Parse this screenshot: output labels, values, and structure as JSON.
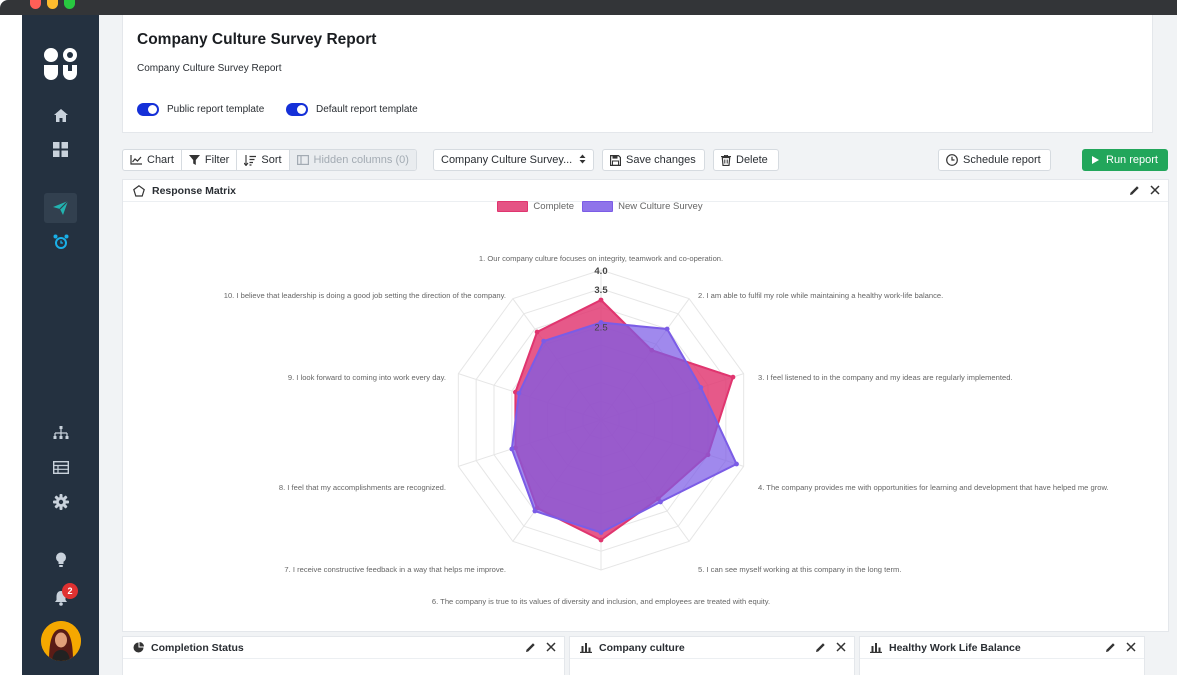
{
  "report": {
    "title": "Company Culture Survey Report",
    "subtitle": "Company Culture Survey Report",
    "toggles": [
      "Public report template",
      "Default report template"
    ]
  },
  "toolbar": {
    "chart": "Chart",
    "filter": "Filter",
    "sort": "Sort",
    "hidden_columns": "Hidden columns (0)",
    "survey_select": "Company Culture Survey...",
    "save": "Save changes",
    "delete": "Delete",
    "schedule": "Schedule report",
    "run": "Run report"
  },
  "sidebar": {
    "notification_count": "2",
    "accent": "#1ab0e8"
  },
  "panels": {
    "matrix_title": "Response Matrix",
    "bottom": [
      "Completion Status",
      "Company culture",
      "Healthy Work Life Balance"
    ]
  },
  "chart_data": {
    "type": "radar",
    "labels": [
      "1. Our company culture focuses on integrity, teamwork and co-operation.",
      "2. I am able to fulfil my role while maintaining a healthy work-life balance.",
      "3. I feel listened to in the company and my ideas are regularly implemented.",
      "4. The company provides me with opportunities for learning and development that have helped me grow.",
      "5. I can see myself working at this company in the long term.",
      "6. The company is true to its values of diversity and inclusion, and employees are treated with equity.",
      "7. I receive constructive feedback in a way that helps me improve.",
      "8. I feel that my accomplishments are recognized.",
      "9. I look forward to coming into work every day.",
      "10. I believe that leadership is doing a good job setting the direction of the company."
    ],
    "tick_labels": [
      "4.0",
      "3.5",
      "2.5"
    ],
    "r_max": 4.0,
    "series": [
      {
        "name": "Complete",
        "color": "#e0356f",
        "values": [
          3.2,
          2.3,
          3.7,
          3.0,
          2.6,
          3.2,
          2.9,
          2.4,
          2.4,
          2.9
        ]
      },
      {
        "name": "New Culture Survey",
        "color": "#7b5ce6",
        "values": [
          2.6,
          3.0,
          2.8,
          3.8,
          2.7,
          3.0,
          3.0,
          2.5,
          2.3,
          2.6
        ]
      }
    ]
  }
}
